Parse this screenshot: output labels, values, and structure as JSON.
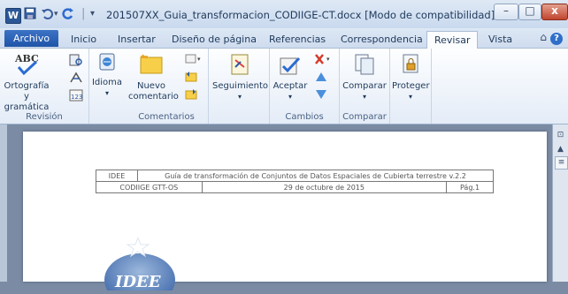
{
  "window": {
    "app_icon": "W",
    "title": "201507XX_Guia_transformacion_CODIIGE-CT.docx [Modo de compatibilidad] - M.",
    "buttons": {
      "minimize": "–",
      "maximize": "□",
      "close": "x"
    }
  },
  "quick_access": [
    {
      "name": "save-icon",
      "glyph": "▣"
    },
    {
      "name": "undo-icon",
      "glyph": "↶"
    },
    {
      "name": "redo-icon",
      "glyph": "↻"
    },
    {
      "name": "customize-icon",
      "glyph": "▾"
    }
  ],
  "tabs": {
    "file": "Archivo",
    "items": [
      "Inicio",
      "Insertar",
      "Diseño de página",
      "Referencias",
      "Correspondencia",
      "Revisar",
      "Vista"
    ],
    "active": "Revisar"
  },
  "ribbon": {
    "groups": {
      "revision": "Revisión",
      "comentarios": "Comentarios",
      "cambios": "Cambios",
      "comparar": "Comparar"
    },
    "buttons": {
      "spelling": "Ortografía y gramática",
      "spelling_icon": "ABC",
      "language": "Idioma",
      "new_comment": "Nuevo comentario",
      "tracking": "Seguimiento",
      "accept": "Aceptar",
      "compare": "Comparar",
      "protect": "Proteger"
    }
  },
  "document": {
    "header": {
      "org": "IDEE",
      "title": "Guía de transformación de Conjuntos de Datos Espaciales de Cubierta terrestre v.2.2",
      "group": "CODIIGE GTT-OS",
      "date": "29 de octubre de 2015",
      "page": "Pág.1"
    },
    "logo_text": "IDEE"
  },
  "colors": {
    "file_tab": "#2a62b8",
    "accent_orange": "#f0a020",
    "chrome_blue": "#c9d9ee"
  }
}
